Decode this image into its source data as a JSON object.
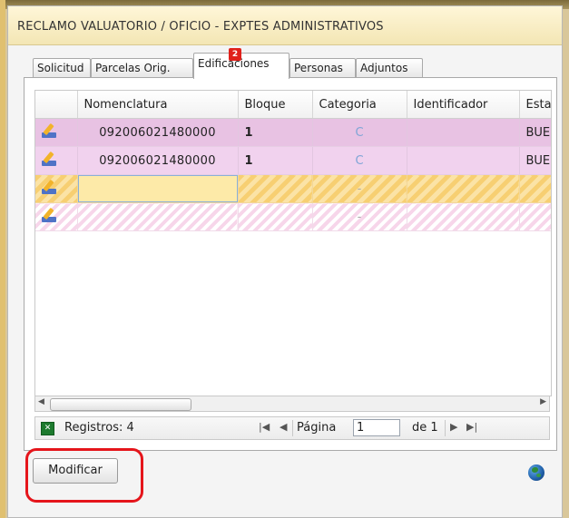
{
  "window": {
    "title": "RECLAMO VALUATORIO / OFICIO  -  EXPTES ADMINISTRATIVOS"
  },
  "tabs": [
    {
      "label": "Solicitud",
      "active": false
    },
    {
      "label": "Parcelas Orig.",
      "active": false
    },
    {
      "label": "Edificaciones",
      "active": true,
      "badge": "2"
    },
    {
      "label": "Personas",
      "active": false
    },
    {
      "label": "Adjuntos",
      "active": false
    }
  ],
  "grid": {
    "columns": [
      "",
      "Nomenclatura",
      "Bloque",
      "Categoria",
      "Identificador",
      "Estado"
    ],
    "rows": [
      {
        "nomenclatura": "092006021480000",
        "bloque": "1",
        "categoria": "C",
        "identificador": "",
        "estado": "BUENO"
      },
      {
        "nomenclatura": "092006021480000",
        "bloque": "1",
        "categoria": "C",
        "identificador": "",
        "estado": "BUENO"
      },
      {
        "nomenclatura": "",
        "bloque": "",
        "categoria": "-",
        "identificador": "",
        "estado": ""
      },
      {
        "nomenclatura": "",
        "bloque": "",
        "categoria": "-",
        "identificador": "",
        "estado": ""
      }
    ]
  },
  "pager": {
    "registros_label": "Registros: 4",
    "pagina_label": "Página",
    "page_value": "1",
    "total_label": "de 1"
  },
  "actions": {
    "modify_label": "Modificar"
  },
  "colors": {
    "highlight": "#e5151b",
    "row_selected": "#e8c2e3",
    "row_new": "#f7cf72"
  }
}
